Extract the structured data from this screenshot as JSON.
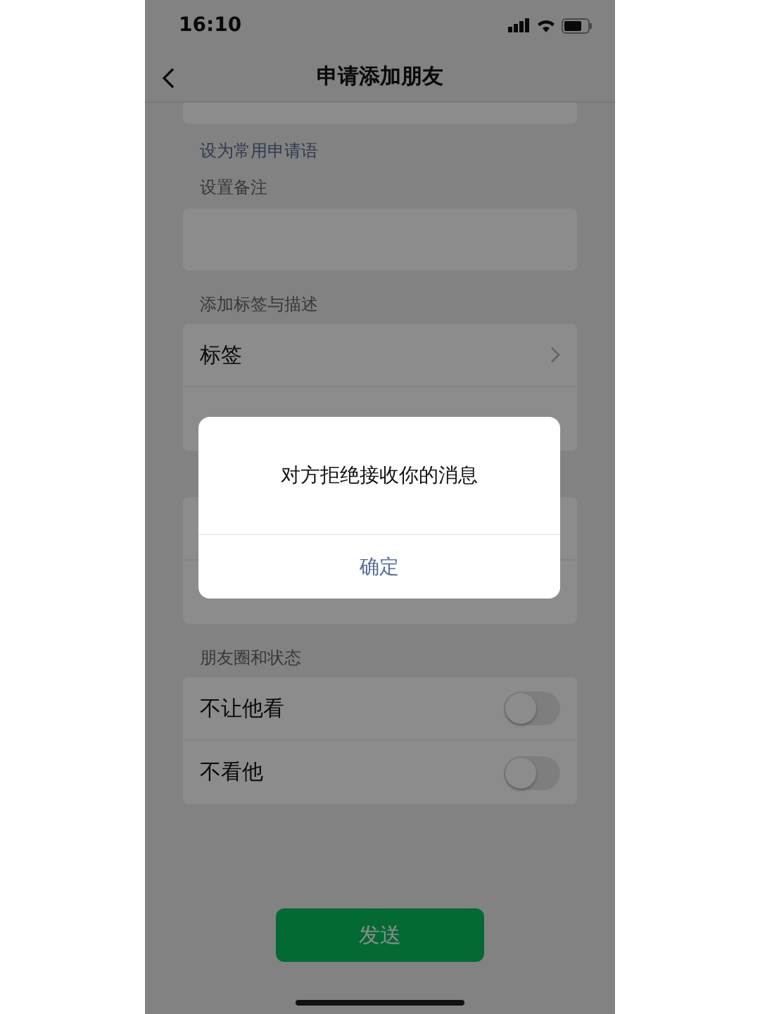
{
  "status_bar": {
    "time": "16:10"
  },
  "nav": {
    "title": "申请添加朋友"
  },
  "common_phrase_link": "设为常用申请语",
  "remark": {
    "label": "设置备注"
  },
  "sections": [
    {
      "header": "添加标签与描述",
      "rows": [
        {
          "kind": "link",
          "label": "标签"
        },
        {
          "kind": "hidden"
        }
      ]
    },
    {
      "rows": [
        {
          "kind": "hidden"
        },
        {
          "kind": "hidden"
        }
      ]
    },
    {
      "header": "朋友圈和状态",
      "rows": [
        {
          "kind": "toggle",
          "label": "不让他看",
          "on": false
        },
        {
          "kind": "toggle",
          "label": "不看他",
          "on": false
        }
      ]
    }
  ],
  "send_button": "发送",
  "dialog": {
    "message": "对方拒绝接收你的消息",
    "button": "确定"
  }
}
